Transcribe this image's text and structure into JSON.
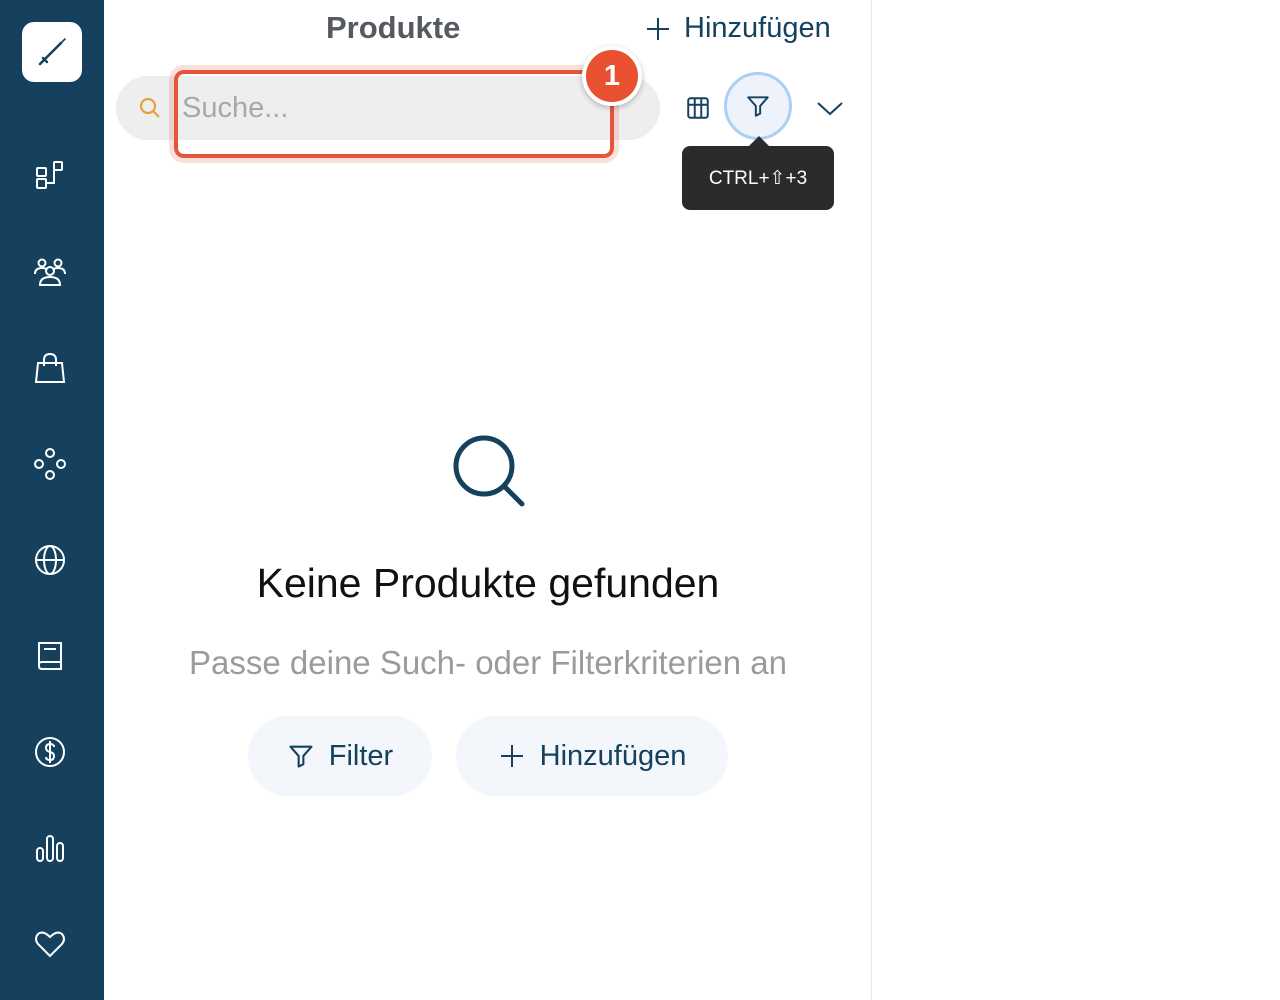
{
  "header": {
    "title": "Produkte",
    "add_label": "Hinzufügen"
  },
  "search": {
    "placeholder": "Suche...",
    "step_badge": "1"
  },
  "toolbar": {
    "tooltip": "CTRL+⇧+3"
  },
  "empty_state": {
    "title": "Keine Produkte gefunden",
    "subtitle": "Passe deine Such- oder Filterkriterien an",
    "filter_label": "Filter",
    "add_label": "Hinzufügen"
  },
  "sidebar": {
    "items": [
      "workflow-icon",
      "team-icon",
      "shopping-bag-icon",
      "network-icon",
      "globe-icon",
      "book-icon",
      "dollar-icon",
      "bar-chart-icon",
      "heart-icon"
    ]
  },
  "colors": {
    "sidebar_bg": "#16415e",
    "accent": "#16415e",
    "highlight": "#e6553a",
    "search_icon": "#e8a13a"
  }
}
